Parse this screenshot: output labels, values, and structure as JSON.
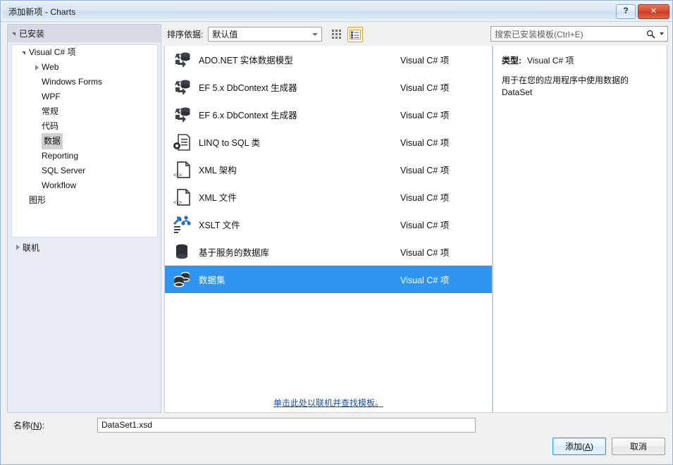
{
  "window": {
    "title": "添加新项 - Charts",
    "help_button": "?",
    "close_button": "✕"
  },
  "toolbar": {
    "sort_label": "排序依据:",
    "sort_value": "默认值",
    "grid_view_tooltip": "中等图标",
    "list_view_tooltip": "列表",
    "active_view": "list"
  },
  "search": {
    "placeholder": "搜索已安装模板(Ctrl+E)",
    "icon": "search-icon"
  },
  "sidebar": {
    "header": "已安装",
    "tree": [
      {
        "label": "Visual C# 项",
        "indent": 0,
        "expander": "open",
        "selected": false
      },
      {
        "label": "Web",
        "indent": 1,
        "expander": "closed",
        "selected": false
      },
      {
        "label": "Windows Forms",
        "indent": 1,
        "expander": "none",
        "selected": false
      },
      {
        "label": "WPF",
        "indent": 1,
        "expander": "none",
        "selected": false
      },
      {
        "label": "常规",
        "indent": 1,
        "expander": "none",
        "selected": false
      },
      {
        "label": "代码",
        "indent": 1,
        "expander": "none",
        "selected": false
      },
      {
        "label": "数据",
        "indent": 1,
        "expander": "none",
        "selected": true
      },
      {
        "label": "Reporting",
        "indent": 1,
        "expander": "none",
        "selected": false
      },
      {
        "label": "SQL Server",
        "indent": 1,
        "expander": "none",
        "selected": false
      },
      {
        "label": "Workflow",
        "indent": 1,
        "expander": "none",
        "selected": false
      },
      {
        "label": "图形",
        "indent": 0,
        "expander": "none",
        "selected": false
      }
    ],
    "online": {
      "label": "联机",
      "expander": "closed"
    }
  },
  "templates": {
    "kind_column": "Visual C# 项",
    "items": [
      {
        "name": "ADO.NET 实体数据模型",
        "kind": "Visual C# 项",
        "icon": "entity-data-model-icon",
        "selected": false
      },
      {
        "name": "EF 5.x DbContext 生成器",
        "kind": "Visual C# 项",
        "icon": "entity-data-model-icon",
        "selected": false
      },
      {
        "name": "EF 6.x DbContext 生成器",
        "kind": "Visual C# 项",
        "icon": "entity-data-model-icon",
        "selected": false
      },
      {
        "name": "LINQ to SQL 类",
        "kind": "Visual C# 项",
        "icon": "linq-to-sql-icon",
        "selected": false
      },
      {
        "name": "XML 架构",
        "kind": "Visual C# 项",
        "icon": "xml-file-icon",
        "selected": false
      },
      {
        "name": "XML 文件",
        "kind": "Visual C# 项",
        "icon": "xml-file-icon",
        "selected": false
      },
      {
        "name": "XSLT 文件",
        "kind": "Visual C# 项",
        "icon": "xslt-file-icon",
        "selected": false
      },
      {
        "name": "基于服务的数据库",
        "kind": "Visual C# 项",
        "icon": "database-icon",
        "selected": false
      },
      {
        "name": "数据集",
        "kind": "Visual C# 项",
        "icon": "dataset-icon",
        "selected": true
      }
    ],
    "online_link": "单击此处以联机并查找模板。"
  },
  "details": {
    "type_label": "类型:",
    "type_value": "Visual C# 项",
    "description": "用于在您的应用程序中使用数据的 DataSet"
  },
  "name_field": {
    "label_prefix": "名称(",
    "label_accel": "N",
    "label_suffix": "):",
    "value": "DataSet1.xsd"
  },
  "footer": {
    "add_prefix": "添加(",
    "add_accel": "A",
    "add_suffix": ")",
    "cancel": "取消"
  },
  "colors": {
    "selection_blue": "#2f95ef",
    "link_blue": "#1b4fa0",
    "accent_gold": "#e0a526",
    "close_red": "#d9492c"
  }
}
